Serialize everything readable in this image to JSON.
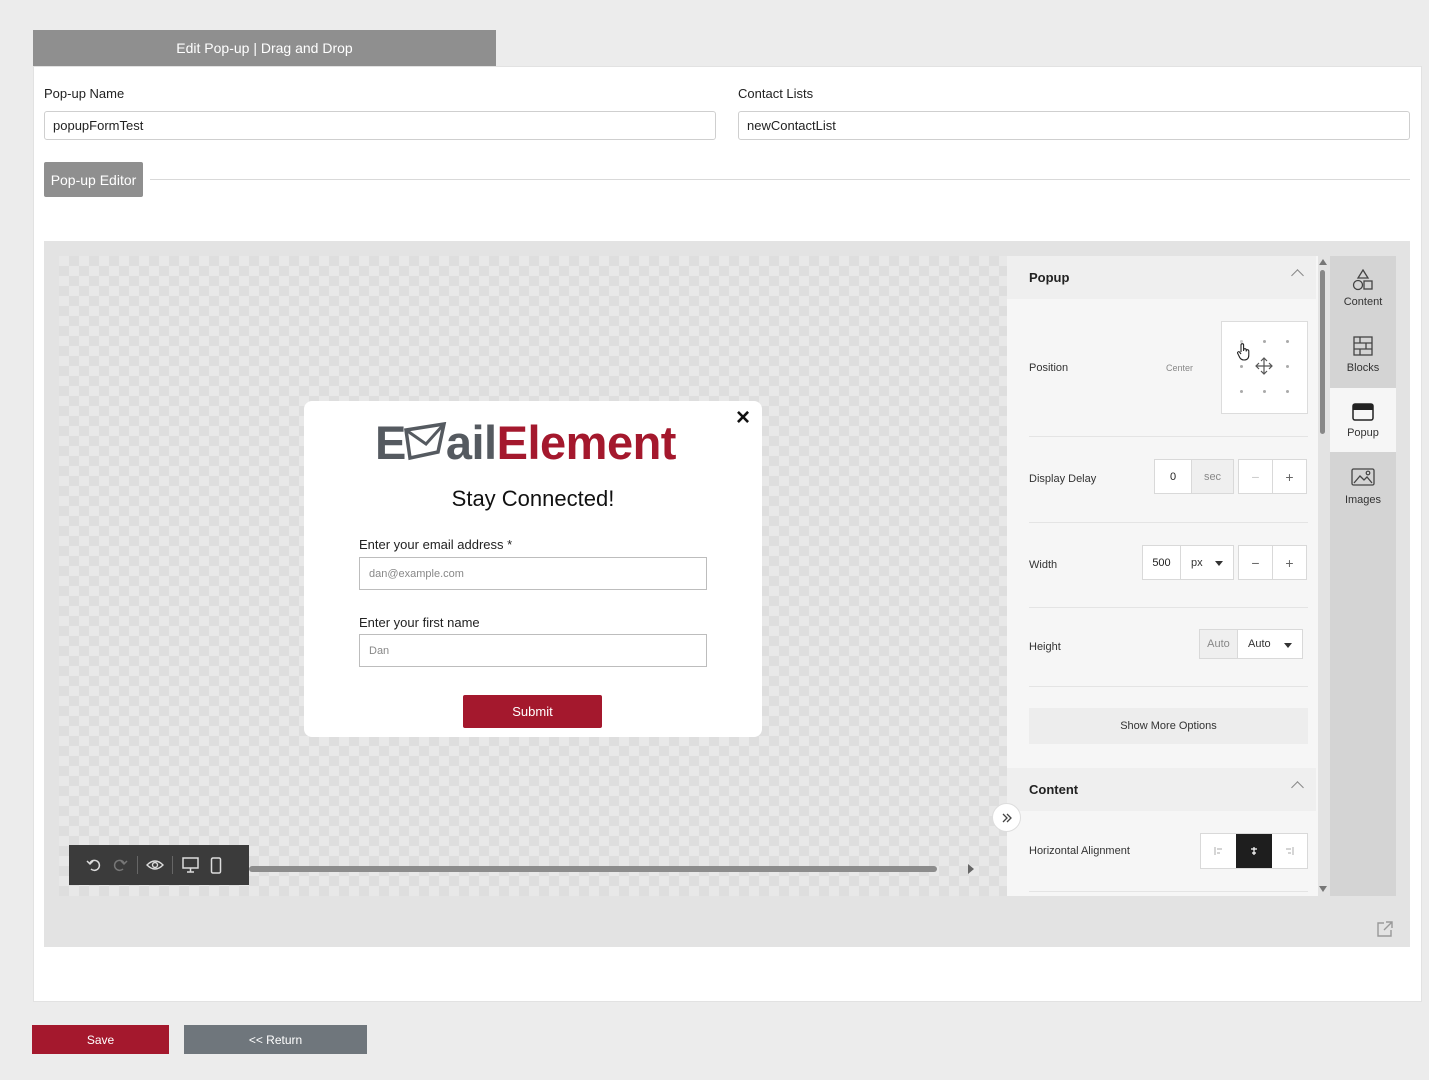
{
  "page": {
    "title": "Edit Pop-up | Drag and Drop"
  },
  "form": {
    "popup_name_label": "Pop-up Name",
    "popup_name_value": "popupFormTest",
    "contact_lists_label": "Contact Lists",
    "contact_lists_value": "newContactList",
    "editor_tab": "Pop-up Editor"
  },
  "popup_preview": {
    "logo_text_1": "E",
    "logo_text_2": "ail",
    "logo_text_3": "Element",
    "close_symbol": "×",
    "heading": "Stay Connected!",
    "email_label": "Enter your email address *",
    "email_placeholder": "dan@example.com",
    "name_label": "Enter your first name",
    "name_placeholder": "Dan",
    "submit_label": "Submit",
    "colors": {
      "brand_red": "#a4182d",
      "logo_gray": "#555a60"
    }
  },
  "toolbar": {
    "icons": [
      "undo-icon",
      "redo-icon",
      "preview-eye-icon",
      "desktop-icon",
      "mobile-icon"
    ]
  },
  "panel": {
    "popup_section": "Popup",
    "position_label": "Position",
    "position_value": "Center",
    "display_delay_label": "Display Delay",
    "display_delay_value": "0",
    "display_delay_unit": "sec",
    "width_label": "Width",
    "width_value": "500",
    "width_unit": "px",
    "height_label": "Height",
    "height_auto_label": "Auto",
    "height_value": "Auto",
    "minus": "−",
    "plus": "+",
    "show_more": "Show More Options",
    "content_section": "Content",
    "h_align_label": "Horizontal Alignment"
  },
  "side_nav": {
    "items": [
      {
        "label": "Content",
        "icon": "shapes-icon"
      },
      {
        "label": "Blocks",
        "icon": "blocks-icon"
      },
      {
        "label": "Popup",
        "icon": "popup-window-icon",
        "active": true
      },
      {
        "label": "Images",
        "icon": "images-icon"
      }
    ]
  },
  "footer": {
    "save_label": "Save",
    "return_label": "<< Return"
  }
}
